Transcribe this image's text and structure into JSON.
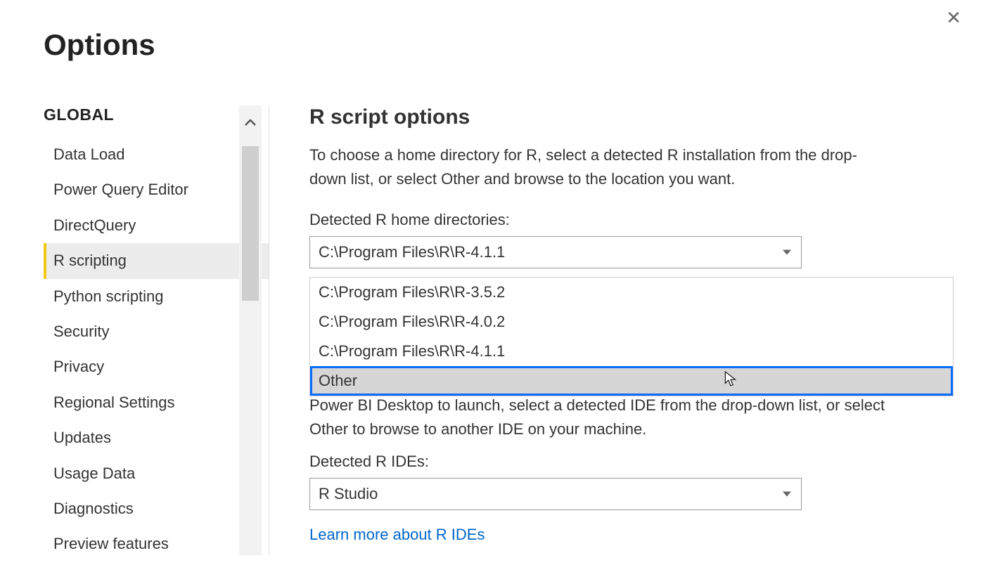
{
  "title": "Options",
  "sidebar": {
    "header": "GLOBAL",
    "items": [
      "Data Load",
      "Power Query Editor",
      "DirectQuery",
      "R scripting",
      "Python scripting",
      "Security",
      "Privacy",
      "Regional Settings",
      "Updates",
      "Usage Data",
      "Diagnostics",
      "Preview features"
    ],
    "selected_index": 3
  },
  "main": {
    "section_title": "R script options",
    "description": "To choose a home directory for R, select a detected R installation from the drop-down list, or select Other and browse to the location you want.",
    "home_dir_label": "Detected R home directories:",
    "home_dir_value": "C:\\Program Files\\R\\R-4.1.1",
    "home_dir_options": [
      "C:\\Program Files\\R\\R-3.5.2",
      "C:\\Program Files\\R\\R-4.0.2",
      "C:\\Program Files\\R\\R-4.1.1",
      "Other"
    ],
    "highlighted_option_index": 3,
    "ide_desc_visible_tail": "Power BI Desktop to launch, select a detected IDE from the drop-down list, or select Other to browse to another IDE on your machine.",
    "ide_label": "Detected R IDEs:",
    "ide_value": "R Studio",
    "ide_link": "Learn more about R IDEs"
  }
}
